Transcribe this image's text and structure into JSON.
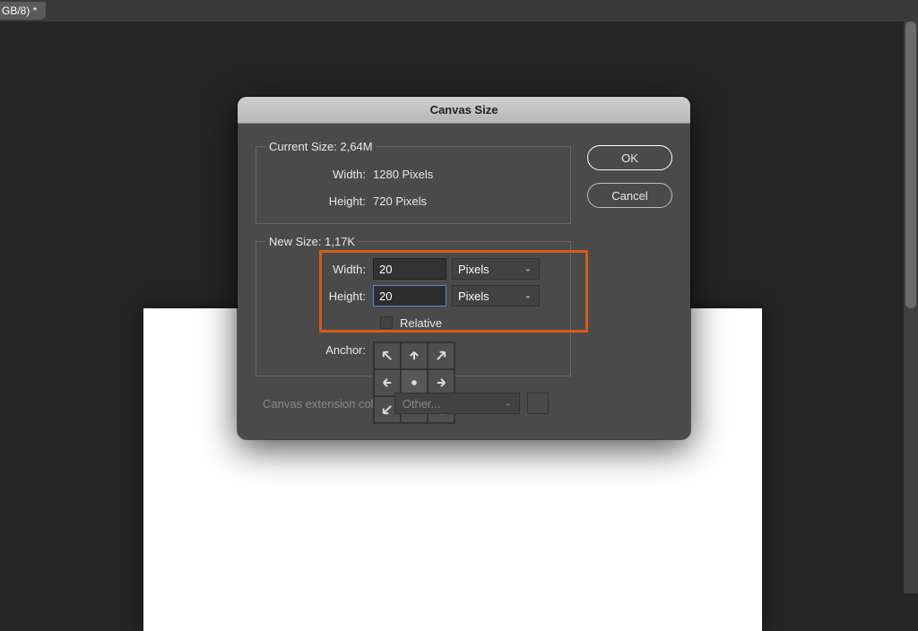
{
  "tabbar": {
    "label": "GB/8) *"
  },
  "dialog": {
    "title": "Canvas Size",
    "ok": "OK",
    "cancel": "Cancel",
    "currentSize": {
      "legend": "Current Size: 2,64M",
      "width_label": "Width:",
      "width_value": "1280 Pixels",
      "height_label": "Height:",
      "height_value": "720 Pixels"
    },
    "newSize": {
      "legend": "New Size: 1,17K",
      "width_label": "Width:",
      "width_value": "20",
      "width_units": "Pixels",
      "height_label": "Height:",
      "height_value": "20",
      "height_units": "Pixels",
      "relative_label": "Relative",
      "anchor_label": "Anchor:"
    },
    "extension": {
      "label": "Canvas extension color:",
      "value": "Other..."
    }
  }
}
